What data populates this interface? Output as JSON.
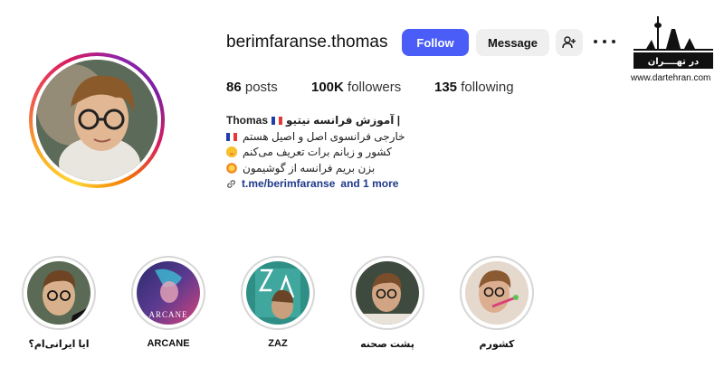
{
  "profile": {
    "username": "berimfaranse.thomas",
    "follow_label": "Follow",
    "message_label": "Message",
    "stats": {
      "posts_count": "86",
      "posts_label": "posts",
      "followers_count": "100K",
      "followers_label": "followers",
      "following_count": "135",
      "following_label": "following"
    },
    "bio": {
      "name": "Thomas",
      "title": "آموزش فرانسه نیتیو |",
      "line1": "خارجی فرانسوی اصل و اصیل هستم",
      "line2": "کشور و زبانم برات تعریف می‌کنم",
      "line3": "بزن بریم فرانسه از گوشیمون",
      "link": "t.me/berimfaranse",
      "link_more": "and 1 more"
    }
  },
  "logo": {
    "text": "در تهــــران",
    "url": "www.dartehran.com"
  },
  "highlights": [
    {
      "label": "ایا ایرانی‌ام؟"
    },
    {
      "label": "ARCANE"
    },
    {
      "label": "ZAZ"
    },
    {
      "label": "پشت صحنه"
    },
    {
      "label": "کشورم"
    }
  ],
  "colors": {
    "follow_button": "#4a5df7",
    "secondary_button": "#efefef",
    "link": "#1e3a8a",
    "story_ring": "#d81b60"
  },
  "icons": {
    "add_user": "person-plus-icon",
    "more": "more-horizontal-icon",
    "link": "link-icon",
    "flag": "france-flag-icon"
  }
}
